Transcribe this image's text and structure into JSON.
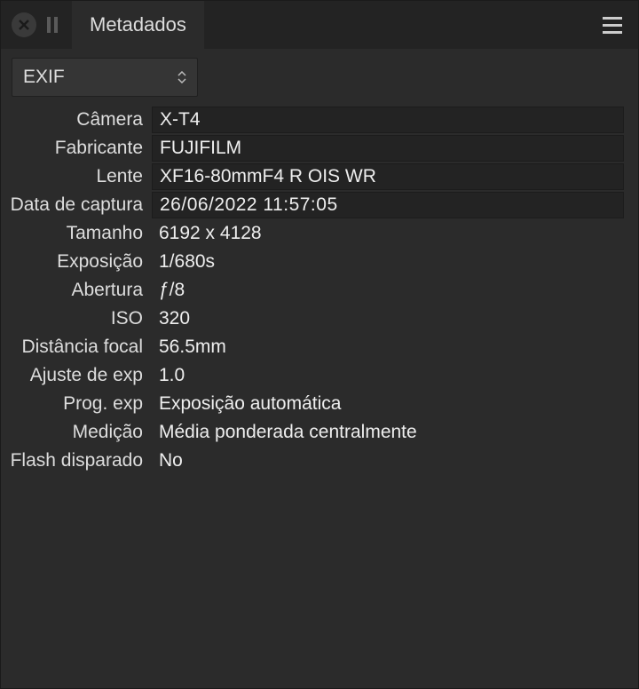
{
  "header": {
    "tab_title": "Metadados"
  },
  "selector": {
    "value": "EXIF"
  },
  "fields": [
    {
      "label": "Câmera",
      "value": "X-T4",
      "editable": true
    },
    {
      "label": "Fabricante",
      "value": "FUJIFILM",
      "editable": true
    },
    {
      "label": "Lente",
      "value": "XF16-80mmF4 R OIS WR",
      "editable": true
    },
    {
      "label": "Data de captura",
      "value": " 26/06/2022  11:57:05",
      "editable": true,
      "date": true
    },
    {
      "label": "Tamanho",
      "value": "6192 x 4128",
      "editable": false
    },
    {
      "label": "Exposição",
      "value": "1/680s",
      "editable": false
    },
    {
      "label": "Abertura",
      "value": "ƒ/8",
      "editable": false
    },
    {
      "label": "ISO",
      "value": "320",
      "editable": false
    },
    {
      "label": "Distância focal",
      "value": "56.5mm",
      "editable": false
    },
    {
      "label": "Ajuste de exp",
      "value": "1.0",
      "editable": false
    },
    {
      "label": "Prog. exp",
      "value": "Exposição automática",
      "editable": false
    },
    {
      "label": "Medição",
      "value": "Média ponderada centralmente",
      "editable": false
    },
    {
      "label": "Flash disparado",
      "value": "No",
      "editable": false
    }
  ]
}
